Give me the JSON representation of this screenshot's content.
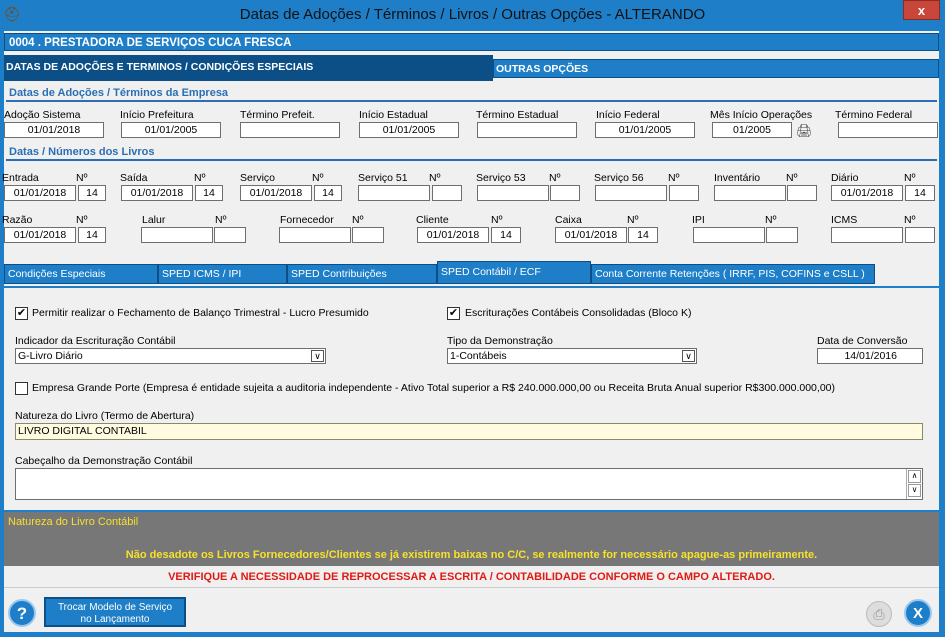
{
  "window": {
    "title": "Datas de Adoções / Términos / Livros / Outras Opções   -   ALTERANDO",
    "close_label": "x",
    "company": "0004   .   PRESTADORA DE SERVIÇOS CUCA FRESCA"
  },
  "main_tabs": {
    "active": "DATAS DE ADOÇÕES E TERMINOS / CONDIÇÕES ESPECIAIS",
    "other": "OUTRAS OPÇÕES"
  },
  "adocoes": {
    "section_title": "Datas de Adoções / Términos da Empresa",
    "fields": [
      {
        "label": "Adoção Sistema",
        "value": "01/01/2018"
      },
      {
        "label": "Início Prefeitura",
        "value": "01/01/2005"
      },
      {
        "label": "Término Prefeit.",
        "value": ""
      },
      {
        "label": "Início Estadual",
        "value": "01/01/2005"
      },
      {
        "label": "Término Estadual",
        "value": ""
      },
      {
        "label": "Início Federal",
        "value": "01/01/2005"
      },
      {
        "label": "Mês Início Operações",
        "value": "01/2005"
      },
      {
        "label": "Término Federal",
        "value": ""
      }
    ]
  },
  "livros": {
    "section_title": "Datas / Números dos Livros",
    "num_label": "Nº",
    "row1": [
      {
        "label": "Entrada",
        "date": "01/01/2018",
        "num": "14"
      },
      {
        "label": "Saída",
        "date": "01/01/2018",
        "num": "14"
      },
      {
        "label": "Serviço",
        "date": "01/01/2018",
        "num": "14"
      },
      {
        "label": "Serviço 51",
        "date": "",
        "num": ""
      },
      {
        "label": "Serviço 53",
        "date": "",
        "num": ""
      },
      {
        "label": "Serviço 56",
        "date": "",
        "num": ""
      },
      {
        "label": "Inventário",
        "date": "",
        "num": ""
      },
      {
        "label": "Diário",
        "date": "01/01/2018",
        "num": "14"
      }
    ],
    "row2": [
      {
        "label": "Razão",
        "date": "01/01/2018",
        "num": "14"
      },
      {
        "label": "Lalur",
        "date": "",
        "num": ""
      },
      {
        "label": "Fornecedor",
        "date": "",
        "num": ""
      },
      {
        "label": "Cliente",
        "date": "01/01/2018",
        "num": "14"
      },
      {
        "label": "Caixa",
        "date": "01/01/2018",
        "num": "14"
      },
      {
        "label": "IPI",
        "date": "",
        "num": ""
      },
      {
        "label": "ICMS",
        "date": "",
        "num": ""
      }
    ]
  },
  "sub_tabs": [
    "Condições Especiais",
    "SPED ICMS / IPI",
    "SPED Contribuições",
    "SPED Contábil / ECF",
    "Conta Corrente Retenções ( IRRF,  PIS,  COFINS  e  CSLL )"
  ],
  "panel": {
    "chk_balanco": {
      "checked": true,
      "label": "Permitir realizar o Fechamento de Balanço Trimestral - Lucro Presumido"
    },
    "chk_consolidadas": {
      "checked": true,
      "label": "Escriturações Contábeis Consolidadas (Bloco K)"
    },
    "indicador_label": "Indicador da Escrituração Contábil",
    "indicador_value": "G-Livro Diário",
    "tipo_label": "Tipo da Demonstração",
    "tipo_value": "1-Contábeis",
    "conversao_label": "Data de Conversão",
    "conversao_value": "14/01/2016",
    "chk_grande_porte": {
      "checked": false,
      "label": "Empresa Grande Porte (Empresa é entidade sujeita a auditoria independente - Ativo Total superior a R$ 240.000.000,00 ou Receita Bruta Anual superior R$300.000.000,00)"
    },
    "natureza_label": "Natureza do Livro (Termo de Abertura)",
    "natureza_value": "LIVRO DIGITAL CONTABIL",
    "cabecalho_label": "Cabeçalho da Demonstração Contábil",
    "cabecalho_value": ""
  },
  "notes": {
    "title": "Natureza do Livro Contábil",
    "warning1": "Não desadote os Livros Fornecedores/Clientes se já existirem baixas no C/C, se realmente for necessário apague-as primeiramente.",
    "warning2": "VERIFIQUE A NECESSIDADE DE REPROCESSAR A ESCRITA / CONTABILIDADE CONFORME O CAMPO ALTERADO."
  },
  "footer": {
    "help_label": "?",
    "trocar_label_1": "Trocar Modelo de Serviço",
    "trocar_label_2": "no Lançamento",
    "exit_label": "X"
  },
  "colors": {
    "accent": "#1e7fc8",
    "dark": "#0c4f86",
    "section": "#2a6fb5",
    "warning_yellow": "#f7e12a",
    "warning_red": "#e01a12"
  }
}
